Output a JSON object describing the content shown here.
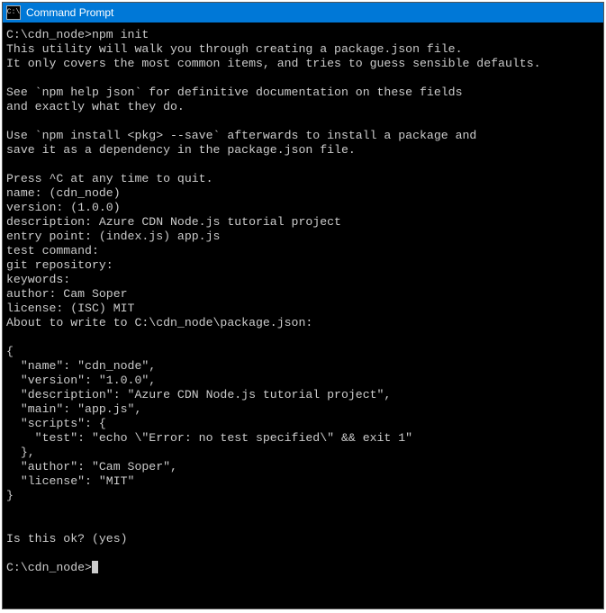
{
  "titlebar": {
    "icon_text": "C:\\",
    "title": "Command Prompt"
  },
  "terminal": {
    "prompt1": "C:\\cdn_node>",
    "command1": "npm init",
    "line1": "This utility will walk you through creating a package.json file.",
    "line2": "It only covers the most common items, and tries to guess sensible defaults.",
    "line3": "See `npm help json` for definitive documentation on these fields",
    "line4": "and exactly what they do.",
    "line5": "Use `npm install <pkg> --save` afterwards to install a package and",
    "line6": "save it as a dependency in the package.json file.",
    "line7": "Press ^C at any time to quit.",
    "name_prompt": "name: (cdn_node)",
    "version_prompt": "version: (1.0.0)",
    "description_prompt": "description: Azure CDN Node.js tutorial project",
    "entry_prompt": "entry point: (index.js) app.js",
    "test_prompt": "test command:",
    "git_prompt": "git repository:",
    "keywords_prompt": "keywords:",
    "author_prompt": "author: Cam Soper",
    "license_prompt": "license: (ISC) MIT",
    "about_line": "About to write to C:\\cdn_node\\package.json:",
    "json_open": "{",
    "json_name": "  \"name\": \"cdn_node\",",
    "json_version": "  \"version\": \"1.0.0\",",
    "json_description": "  \"description\": \"Azure CDN Node.js tutorial project\",",
    "json_main": "  \"main\": \"app.js\",",
    "json_scripts_open": "  \"scripts\": {",
    "json_test": "    \"test\": \"echo \\\"Error: no test specified\\\" && exit 1\"",
    "json_scripts_close": "  },",
    "json_author": "  \"author\": \"Cam Soper\",",
    "json_license": "  \"license\": \"MIT\"",
    "json_close": "}",
    "confirm_prompt": "Is this ok? (yes)",
    "prompt2": "C:\\cdn_node>"
  }
}
